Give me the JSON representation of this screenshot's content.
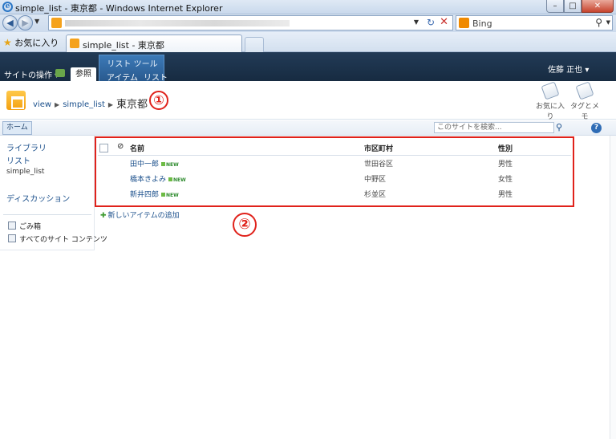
{
  "window": {
    "title": "simple_list - 東京都 - Windows Internet Explorer",
    "minimize": "–",
    "maximize": "□",
    "close": "✕"
  },
  "browser": {
    "search_engine": "Bing",
    "favorites_label": "お気に入り",
    "tab_title": "simple_list - 東京都"
  },
  "ribbon": {
    "site_actions": "サイトの操作 ▾",
    "browse_tab": "参照",
    "context_group": "リスト ツール",
    "items_tab": "アイテム",
    "list_tab": "リスト",
    "user": "佐藤 正也 ▾"
  },
  "breadcrumb": {
    "items": [
      "view",
      "simple_list",
      "東京都"
    ]
  },
  "page_actions": {
    "favorite": "お気に入り",
    "tags_notes": "タグとメモ"
  },
  "topbar": {
    "home_tab": "ホーム",
    "search_placeholder": "このサイトを検索..."
  },
  "quick_launch": {
    "libraries": "ライブラリ",
    "lists": "リスト",
    "list_sub": "simple_list",
    "discussions": "ディスカッション",
    "recycle_bin": "ごみ箱",
    "all_content": "すべてのサイト コンテンツ"
  },
  "list": {
    "columns": [
      "名前",
      "市区町村",
      "性別"
    ],
    "new_badge": "NEW",
    "rows": [
      {
        "name": "田中一郎",
        "city": "世田谷区",
        "sex": "男性"
      },
      {
        "name": "橋本きよみ",
        "city": "中野区",
        "sex": "女性"
      },
      {
        "name": "新井四郎",
        "city": "杉並区",
        "sex": "男性"
      }
    ],
    "add_item": "新しいアイテムの追加"
  },
  "callouts": {
    "one": "①",
    "two": "②"
  },
  "colors": {
    "ribbon": "#1c324b",
    "link": "#1a4f8b",
    "highlight": "#e0221b"
  }
}
